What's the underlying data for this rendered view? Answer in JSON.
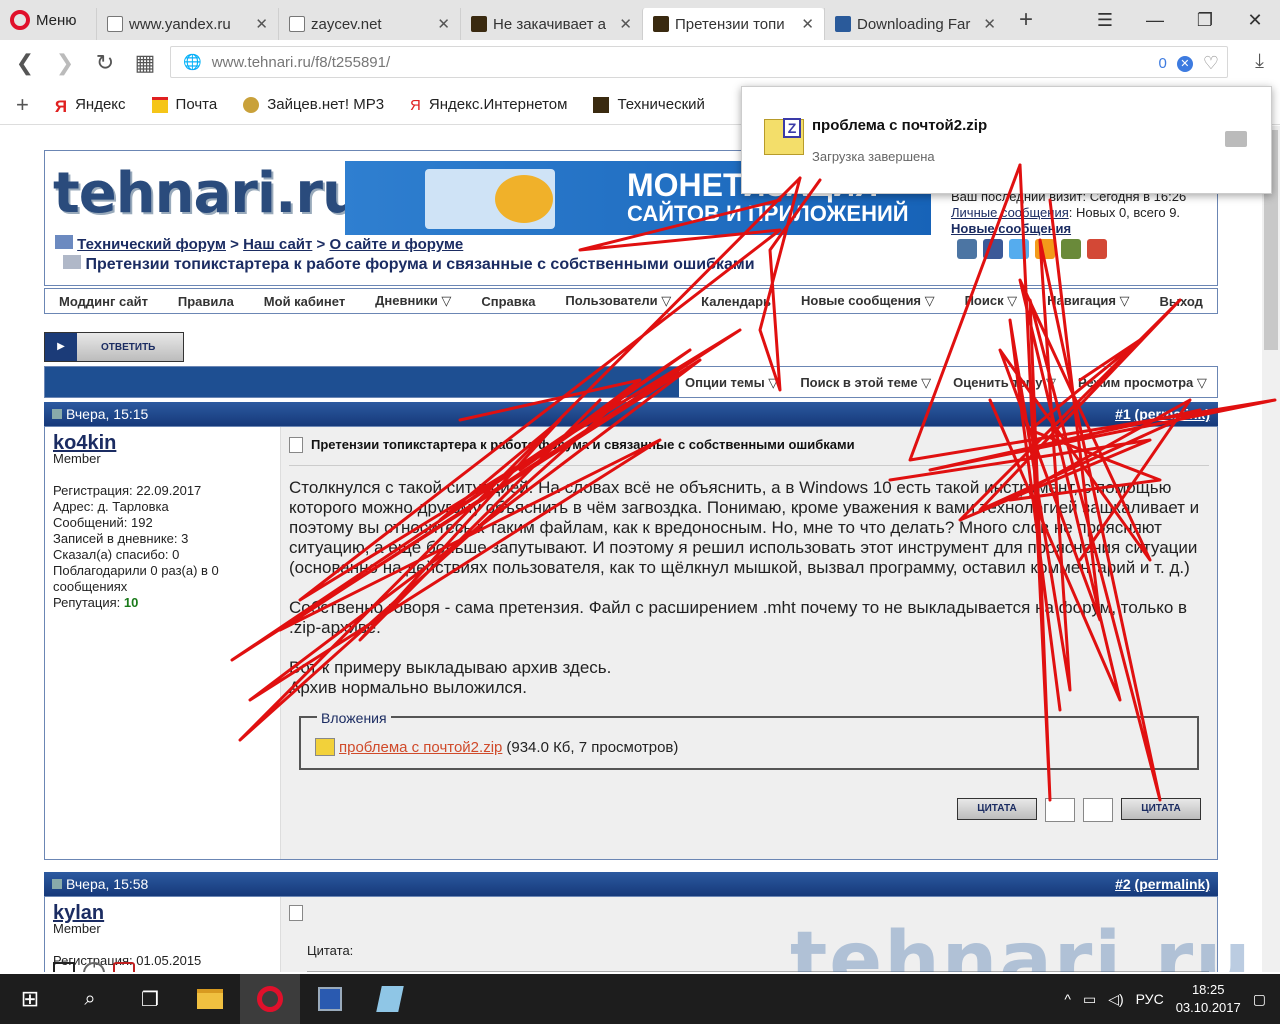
{
  "browser": {
    "menu_label": "Меню",
    "tabs": [
      {
        "title": "www.yandex.ru",
        "icon": "document-icon"
      },
      {
        "title": "zaycev.net",
        "icon": "document-icon"
      },
      {
        "title": "Не закачивает а",
        "icon": "tehnari-icon"
      },
      {
        "title": "Претензии топи",
        "icon": "tehnari-icon",
        "active": true
      },
      {
        "title": "Downloading Far",
        "icon": "far-icon"
      }
    ],
    "url_host": "www.tehnari.ru",
    "url_path": "/f8/t255891/",
    "adblock_count": "0",
    "bookmarks": [
      {
        "label": "Яндекс"
      },
      {
        "label": "Почта"
      },
      {
        "label": "Зайцев.нет! MP3"
      },
      {
        "label": "Яндекс.Интернетом"
      },
      {
        "label": "Технический"
      }
    ]
  },
  "download_popup": {
    "file_name": "проблема с почтой2.zip",
    "status": "Загрузка завершена"
  },
  "forum": {
    "logo": "tehnari.ru",
    "banner_line1": "МОНЕТИЗАЦИЯ",
    "banner_line2": "САЙТОВ И ПРИЛОЖЕНИЙ",
    "breadcrumb": [
      "Технический форум",
      "Наш сайт",
      "О сайте и форуме"
    ],
    "breadcrumb_sep": ">",
    "thread_title": "Претензии топикстартера к работе форума и связанные с собственными ошибками",
    "last_visit": "Ваш последний визит: Сегодня в 16:26",
    "pm_label": "Личные сообщения",
    "pm_counts": ": Новых 0, всего 9.",
    "new_posts_label": "Новые сообщения",
    "navbar": [
      "Моддинг сайт",
      "Правила",
      "Мой кабинет",
      "Дневники ▽",
      "Справка",
      "Пользователи ▽",
      "Календарь",
      "Новые сообщения ▽",
      "Поиск ▽",
      "Навигация ▽",
      "Выход"
    ],
    "reply_button": "ОТВЕТИТЬ",
    "thread_options": [
      "Опции темы ▽",
      "Поиск в этой теме ▽",
      "Оценить тему ▽",
      "Режим просмотра ▽"
    ]
  },
  "posts": [
    {
      "date": "Вчера, 15:15",
      "number": "#1",
      "permalink": "(permalink)",
      "username": "ko4kin",
      "role": "Member",
      "stats": [
        "Регистрация: 22.09.2017",
        "Адрес: д. Тарловка",
        "Сообщений: 192",
        "Записей в дневнике: 3",
        "Сказал(а) спасибо: 0",
        "Поблагодарили 0 раз(а) в 0 сообщениях"
      ],
      "reputation_label": "Репутация:",
      "reputation_value": "10",
      "title": "Претензии топикстартера к работе форума и связанные с собственными ошибками",
      "paragraphs": [
        "Столкнулся с такой ситуацией. На словах всё не объяснить, а в Windows 10 есть такой инструмент, с помощью которого можно другому объяснить в чём загвоздка. Понимаю, кроме уважения к вами технологией зашкаливает и поэтому вы относитесь к таким файлам, как к вредоносным. Но, мне то что делать? Много слов не проясняют ситуацию, а ещё больше запутывают. И поэтому я решил использовать этот инструмент для прояснения ситуации (основанно на действиях пользователя, как то щёлкнул мышкой, вызвал программу, оставил комментарий и т. д.)",
        "Собственно говоря - сама претензия. Файл с расширением .mht почему то не выкладывается на форум, только в .zip-архиве.",
        "Вот к примеру выкладываю архив здесь.",
        "Архив нормально выложился."
      ],
      "attachments_legend": "Вложения",
      "attachment_name": "проблема с почтой2.zip",
      "attachment_meta": "(934.0 Кб, 7 просмотров)",
      "quote_button": "ЦИТАТА"
    },
    {
      "date": "Вчера, 15:58",
      "number": "#2",
      "permalink": "(permalink)",
      "username": "kylan",
      "role": "Member",
      "stats": [
        "Регистрация: 01.05.2015"
      ],
      "quote_label": "Цитата:"
    }
  ],
  "watermark": "tehnari.ru",
  "taskbar": {
    "lang": "РУС",
    "time": "18:25",
    "date": "03.10.2017"
  }
}
